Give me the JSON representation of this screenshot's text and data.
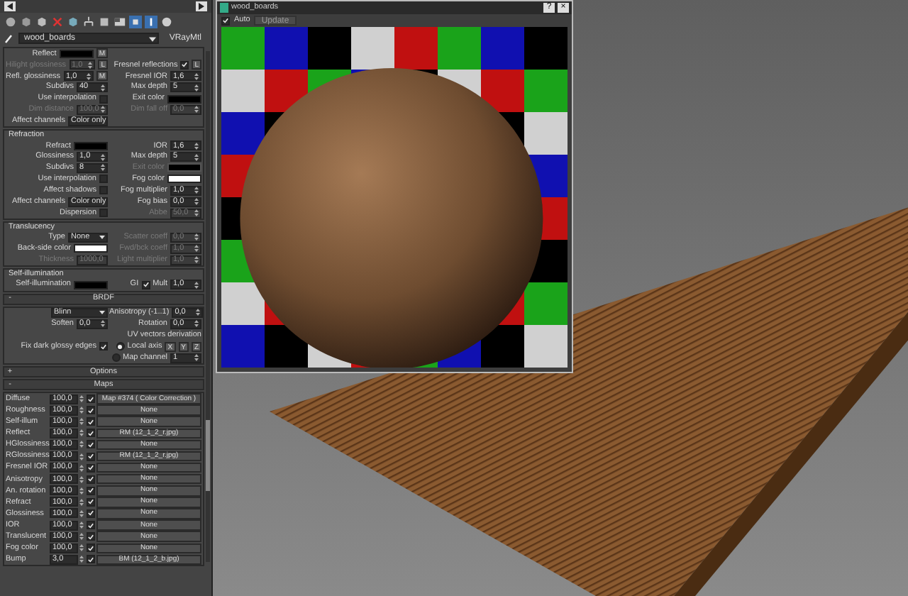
{
  "toolbar": {
    "material_name": "wood_boards",
    "material_type": "VRayMtl"
  },
  "sections": [
    {
      "kind": "group",
      "rows": [
        {
          "left": [
            {
              "kind": "color",
              "label": "Reflect",
              "color": "#000000",
              "button": "M"
            }
          ],
          "right": []
        },
        {
          "left": [
            {
              "kind": "spinner",
              "label": "Hilight glossiness",
              "value": "1,0",
              "disabled": true,
              "button": "L"
            }
          ],
          "right": [
            {
              "kind": "checkbox",
              "label": "Fresnel reflections",
              "checked": true,
              "button": "L"
            }
          ]
        },
        {
          "left": [
            {
              "kind": "spinner",
              "label": "Refl. glossiness",
              "value": "1,0",
              "button": "M"
            }
          ],
          "right": [
            {
              "kind": "spinner",
              "label": "Fresnel IOR",
              "value": "1,6"
            }
          ]
        },
        {
          "left": [
            {
              "kind": "spinner",
              "label": "Subdivs",
              "value": "40"
            }
          ],
          "right": [
            {
              "kind": "spinner",
              "label": "Max depth",
              "value": "5"
            }
          ]
        },
        {
          "left": [
            {
              "kind": "checkbox",
              "label": "Use interpolation",
              "checked": false
            }
          ],
          "right": [
            {
              "kind": "color",
              "label": "Exit color",
              "color": "#000000"
            }
          ]
        },
        {
          "left": [
            {
              "kind": "spinner",
              "label": "Dim distance",
              "value": "100,0",
              "disabled": true
            }
          ],
          "right": [
            {
              "kind": "spinner",
              "label": "Dim fall off",
              "value": "0,0",
              "disabled": true
            }
          ]
        },
        {
          "left": [
            {
              "kind": "dropdown",
              "label": "Affect channels",
              "value": "Color only"
            }
          ],
          "right": []
        }
      ]
    },
    {
      "kind": "group",
      "title": "Refraction",
      "rows": [
        {
          "left": [
            {
              "kind": "color",
              "label": "Refract",
              "color": "#000000"
            }
          ],
          "right": [
            {
              "kind": "spinner",
              "label": "IOR",
              "value": "1,6"
            }
          ]
        },
        {
          "left": [
            {
              "kind": "spinner",
              "label": "Glossiness",
              "value": "1,0"
            }
          ],
          "right": [
            {
              "kind": "spinner",
              "label": "Max depth",
              "value": "5"
            }
          ]
        },
        {
          "left": [
            {
              "kind": "spinner",
              "label": "Subdivs",
              "value": "8"
            }
          ],
          "right": [
            {
              "kind": "color",
              "label": "Exit color",
              "color": "#000000",
              "disabled": true
            }
          ]
        },
        {
          "left": [
            {
              "kind": "checkbox",
              "label": "Use interpolation",
              "checked": false
            }
          ],
          "right": [
            {
              "kind": "color",
              "label": "Fog color",
              "color": "#ffffff"
            }
          ]
        },
        {
          "left": [
            {
              "kind": "checkbox",
              "label": "Affect shadows",
              "checked": false
            }
          ],
          "right": [
            {
              "kind": "spinner",
              "label": "Fog multiplier",
              "value": "1,0"
            }
          ]
        },
        {
          "left": [
            {
              "kind": "dropdown",
              "label": "Affect channels",
              "value": "Color only"
            }
          ],
          "right": [
            {
              "kind": "spinner",
              "label": "Fog bias",
              "value": "0,0"
            }
          ]
        },
        {
          "left": [
            {
              "kind": "checkbox",
              "label": "Dispersion",
              "checked": false
            }
          ],
          "right": [
            {
              "kind": "spinner",
              "label": "Abbe",
              "value": "50,0",
              "disabled": true
            }
          ]
        }
      ]
    },
    {
      "kind": "group",
      "title": "Translucency",
      "rows": [
        {
          "left": [
            {
              "kind": "dropdown",
              "label": "Type",
              "value": "None"
            }
          ],
          "right": [
            {
              "kind": "spinner",
              "label": "Scatter coeff",
              "value": "0,0",
              "disabled": true
            }
          ]
        },
        {
          "left": [
            {
              "kind": "color",
              "label": "Back-side color",
              "color": "#ffffff"
            }
          ],
          "right": [
            {
              "kind": "spinner",
              "label": "Fwd/bck coeff",
              "value": "1,0",
              "disabled": true
            }
          ]
        },
        {
          "left": [
            {
              "kind": "spinner",
              "label": "Thickness",
              "value": "1000,0",
              "disabled": true
            }
          ],
          "right": [
            {
              "kind": "spinner",
              "label": "Light multiplier",
              "value": "1,0",
              "disabled": true
            }
          ]
        }
      ]
    },
    {
      "kind": "group",
      "title": "Self-illumination",
      "rows": [
        {
          "left": [
            {
              "kind": "color",
              "label": "Self-illumination",
              "color": "#000000"
            }
          ],
          "right": [
            {
              "kind": "checkbox",
              "label": "GI",
              "checked": true
            },
            {
              "kind": "spinner",
              "label": "Mult",
              "value": "1,0"
            }
          ]
        }
      ]
    },
    {
      "kind": "rollout",
      "marker": "-",
      "title": "BRDF",
      "rows": [
        {
          "left": [
            {
              "kind": "dropdown",
              "value": "Blinn"
            }
          ],
          "right": [
            {
              "kind": "spinner",
              "label": "Anisotropy (-1..1)",
              "value": "0,0"
            }
          ]
        },
        {
          "left": [
            {
              "kind": "spinner",
              "label": "Soften",
              "value": "0,0"
            }
          ],
          "right": [
            {
              "kind": "spinner",
              "label": "Rotation",
              "value": "0,0"
            }
          ]
        },
        {
          "left": [],
          "right": [
            {
              "kind": "caption",
              "label": "UV vectors derivation"
            }
          ]
        },
        {
          "left": [
            {
              "kind": "checkbox",
              "label": "Fix dark glossy edges",
              "checked": true
            }
          ],
          "right": [
            {
              "kind": "radio",
              "label": "Local axis",
              "selected": true
            },
            {
              "kind": "buttons",
              "values": [
                "X",
                "Y",
                "Z"
              ]
            }
          ]
        },
        {
          "left": [],
          "right": [
            {
              "kind": "radio",
              "label": "Map channel",
              "selected": false
            },
            {
              "kind": "spinner",
              "value": "1"
            }
          ]
        }
      ]
    },
    {
      "kind": "rollout",
      "marker": "+",
      "title": "Options"
    },
    {
      "kind": "maps",
      "marker": "-",
      "title": "Maps",
      "maps": [
        {
          "label": "Diffuse",
          "amount": "100,0",
          "checked": true,
          "map": "Map #374 ( Color Correction )"
        },
        {
          "label": "Roughness",
          "amount": "100,0",
          "checked": true,
          "map": "None"
        },
        {
          "label": "Self-illum",
          "amount": "100,0",
          "checked": true,
          "map": "None"
        },
        {
          "label": "Reflect",
          "amount": "100,0",
          "checked": true,
          "map": "RM (12_1_2_r.jpg)"
        },
        {
          "label": "HGlossiness",
          "amount": "100,0",
          "checked": true,
          "map": "None"
        },
        {
          "label": "RGlossiness",
          "amount": "100,0",
          "checked": true,
          "map": "RM (12_1_2_r.jpg)"
        },
        {
          "label": "Fresnel IOR",
          "amount": "100,0",
          "checked": true,
          "map": "None"
        },
        {
          "label": "Anisotropy",
          "amount": "100,0",
          "checked": true,
          "map": "None"
        },
        {
          "label": "An. rotation",
          "amount": "100,0",
          "checked": true,
          "map": "None"
        },
        {
          "label": "Refract",
          "amount": "100,0",
          "checked": true,
          "map": "None"
        },
        {
          "label": "Glossiness",
          "amount": "100,0",
          "checked": true,
          "map": "None"
        },
        {
          "label": "IOR",
          "amount": "100,0",
          "checked": true,
          "map": "None"
        },
        {
          "label": "Translucent",
          "amount": "100,0",
          "checked": true,
          "map": "None"
        },
        {
          "label": "Fog color",
          "amount": "100,0",
          "checked": true,
          "map": "None"
        },
        {
          "label": "Bump",
          "amount": "3,0",
          "checked": true,
          "map": "BM (12_1_2_b.jpg)"
        }
      ]
    }
  ],
  "preview": {
    "title": "wood_boards",
    "help": "?",
    "close": "×",
    "auto": {
      "label": "Auto",
      "checked": true
    },
    "update": "Update"
  }
}
